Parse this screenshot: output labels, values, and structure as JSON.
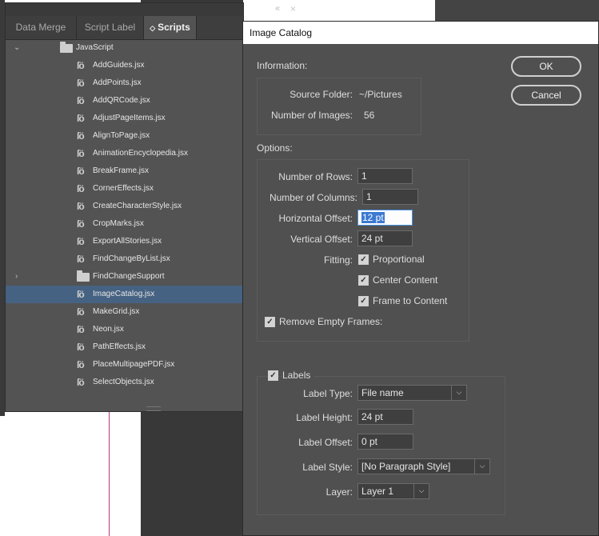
{
  "scripts_panel": {
    "tabs": [
      "Data Merge",
      "Script Label",
      "Scripts"
    ],
    "active_tab": "Scripts",
    "root_folder": "JavaScript",
    "items": [
      "AddGuides.jsx",
      "AddPoints.jsx",
      "AddQRCode.jsx",
      "AdjustPageItems.jsx",
      "AlignToPage.jsx",
      "AnimationEncyclopedia.jsx",
      "BreakFrame.jsx",
      "CornerEffects.jsx",
      "CreateCharacterStyle.jsx",
      "CropMarks.jsx",
      "ExportAllStories.jsx",
      "FindChangeByList.jsx",
      "FindChangeSupport",
      "ImageCatalog.jsx",
      "MakeGrid.jsx",
      "Neon.jsx",
      "PathEffects.jsx",
      "PlaceMultipagePDF.jsx",
      "SelectObjects.jsx"
    ],
    "selected_item": "ImageCatalog.jsx"
  },
  "dialog": {
    "title": "Image Catalog",
    "ok_label": "OK",
    "cancel_label": "Cancel",
    "information": {
      "heading": "Information:",
      "source_folder_label": "Source Folder:",
      "source_folder_value": "~/Pictures",
      "num_images_label": "Number of Images:",
      "num_images_value": "56"
    },
    "options": {
      "heading": "Options:",
      "rows_label": "Number of Rows:",
      "rows_value": "1",
      "cols_label": "Number of Columns:",
      "cols_value": "1",
      "hoffset_label": "Horizontal Offset:",
      "hoffset_value": "12 pt",
      "voffset_label": "Vertical Offset:",
      "voffset_value": "24 pt",
      "fitting_label": "Fitting:",
      "proportional": "Proportional",
      "center_content": "Center Content",
      "frame_to_content": "Frame to Content",
      "remove_empty_frames": "Remove Empty Frames:"
    },
    "labels": {
      "heading": "Labels",
      "type_label": "Label Type:",
      "type_value": "File name",
      "height_label": "Label Height:",
      "height_value": "24 pt",
      "offset_label": "Label Offset:",
      "offset_value": "0 pt",
      "style_label": "Label Style:",
      "style_value": "[No Paragraph Style]",
      "layer_label": "Layer:",
      "layer_value": "Layer 1"
    }
  }
}
